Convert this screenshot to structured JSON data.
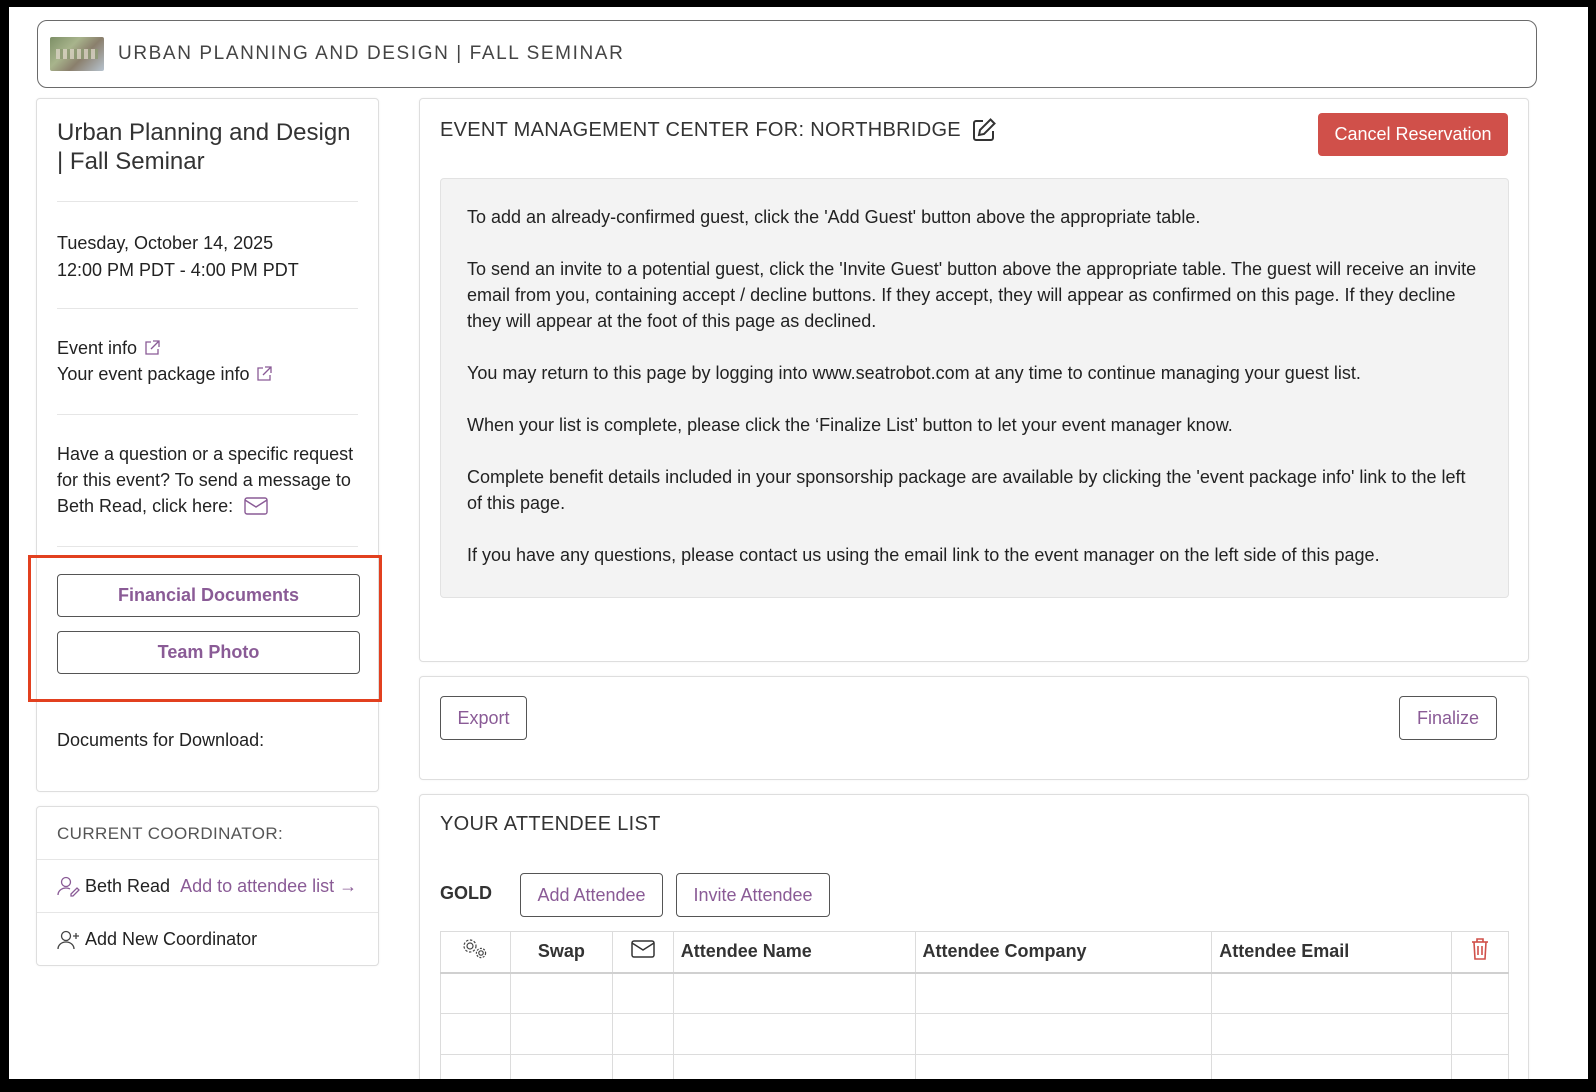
{
  "header": {
    "title": "URBAN PLANNING AND DESIGN | FALL SEMINAR"
  },
  "sidebar": {
    "event_title": "Urban Planning and Design | Fall Seminar",
    "date": "Tuesday, October 14, 2025",
    "time": "12:00 PM PDT - 4:00 PM PDT",
    "event_info_link": "Event info",
    "package_info_link": "Your event package info",
    "question_text": "Have a question or a specific request for this event? To send a message to Beth Read, click here:",
    "buttons": {
      "financial": "Financial Documents",
      "team_photo": "Team Photo"
    },
    "documents_label": "Documents for Download:"
  },
  "coordinator": {
    "heading": "CURRENT COORDINATOR:",
    "name": "Beth Read",
    "add_link": "Add to attendee list →",
    "add_new": "Add New Coordinator"
  },
  "management": {
    "title": "EVENT MANAGEMENT CENTER FOR: NORTHBRIDGE",
    "cancel_button": "Cancel Reservation",
    "instructions": [
      "To add an already-confirmed guest, click the 'Add Guest' button above the appropriate table.",
      "To send an invite to a potential guest, click the 'Invite Guest' button above the appropriate table. The guest will receive an invite email from you, containing accept / decline buttons. If they accept, they will appear as confirmed on this page. If they decline they will appear at the foot of this page as declined.",
      "You may return to this page by logging into www.seatrobot.com at any time to continue managing your guest list.",
      "When your list is complete, please click the ‘Finalize List’ button to let your event manager know.",
      "Complete benefit details included in your sponsorship package are available by clicking the 'event package info' link to the left of this page.",
      "If you have any questions, please contact us using the email link to the event manager on the left side of this page."
    ]
  },
  "actions": {
    "export": "Export",
    "finalize": "Finalize"
  },
  "attendees": {
    "title": "YOUR ATTENDEE LIST",
    "level": "GOLD",
    "add_button": "Add Attendee",
    "invite_button": "Invite Attendee",
    "columns": {
      "swap": "Swap",
      "name": "Attendee Name",
      "company": "Attendee Company",
      "email": "Attendee Email"
    }
  },
  "colors": {
    "accent": "#8a5b96",
    "danger": "#d0504a",
    "highlight": "#e2401f"
  },
  "icons": [
    "external-link-icon",
    "envelope-icon",
    "edit-icon",
    "user-edit-icon",
    "user-plus-icon",
    "gears-icon",
    "trash-icon"
  ]
}
